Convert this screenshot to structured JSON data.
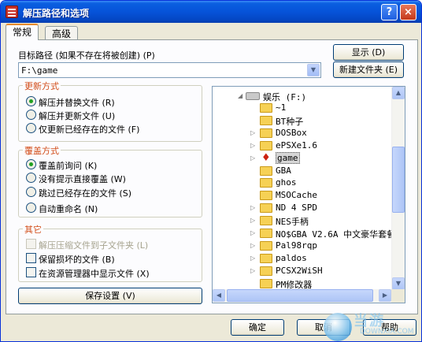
{
  "window": {
    "title": "解压路径和选项",
    "help_glyph": "?",
    "close_glyph": "×"
  },
  "tabs": [
    {
      "label": "常规",
      "active": true
    },
    {
      "label": "高级",
      "active": false
    }
  ],
  "destination": {
    "label": "目标路径 (如果不存在将被创建) (P)",
    "value": "F:\\game",
    "show_button": "显示 (D)",
    "new_folder_button": "新建文件夹 (E)",
    "combo_arrow": "▼"
  },
  "update_mode": {
    "title": "更新方式",
    "options": [
      {
        "label": "解压并替换文件 (R)",
        "selected": true
      },
      {
        "label": "解压并更新文件 (U)",
        "selected": false
      },
      {
        "label": "仅更新已经存在的文件 (F)",
        "selected": false
      }
    ]
  },
  "overwrite_mode": {
    "title": "覆盖方式",
    "options": [
      {
        "label": "覆盖前询问 (K)",
        "selected": true
      },
      {
        "label": "没有提示直接覆盖 (W)",
        "selected": false
      },
      {
        "label": "跳过已经存在的文件 (S)",
        "selected": false
      },
      {
        "label": "自动重命名 (N)",
        "selected": false
      }
    ]
  },
  "misc": {
    "title": "其它",
    "options": [
      {
        "label": "解压压缩文件到子文件夹 (L)",
        "checked": false,
        "disabled": true
      },
      {
        "label": "保留损坏的文件 (B)",
        "checked": false,
        "disabled": false
      },
      {
        "label": "在资源管理器中显示文件 (X)",
        "checked": false,
        "disabled": false
      }
    ]
  },
  "save_button": "保存设置 (V)",
  "tree": {
    "root": "娱乐 (F:)",
    "items": [
      {
        "name": "~1",
        "expandable": false
      },
      {
        "name": "BT种子",
        "expandable": false
      },
      {
        "name": "DOSBox",
        "expandable": true
      },
      {
        "name": "ePSXe1.6",
        "expandable": true
      },
      {
        "name": "game",
        "expandable": true,
        "selected": true
      },
      {
        "name": "GBA",
        "expandable": false
      },
      {
        "name": "ghos",
        "expandable": false
      },
      {
        "name": "MSOCache",
        "expandable": false
      },
      {
        "name": "ND 4 SPD",
        "expandable": true
      },
      {
        "name": "NES手柄",
        "expandable": true
      },
      {
        "name": "NO$GBA V2.6A 中文豪华套餐",
        "expandable": true
      },
      {
        "name": "Pal98rqp",
        "expandable": true
      },
      {
        "name": "paldos",
        "expandable": true
      },
      {
        "name": "PCSX2WiSH",
        "expandable": true
      },
      {
        "name": "PM修改器",
        "expandable": false
      }
    ],
    "scroll_up": "▲",
    "scroll_down": "▼",
    "scroll_left": "◀",
    "scroll_right": "▶",
    "expand_glyph": "▷",
    "root_expand_glyph": "◢",
    "folder_icon": "folder-icon"
  },
  "footer": {
    "ok": "确定",
    "cancel": "取消",
    "help": "帮助"
  },
  "watermark": {
    "text": "当游",
    "sub": "DOWNXIA.COM"
  }
}
